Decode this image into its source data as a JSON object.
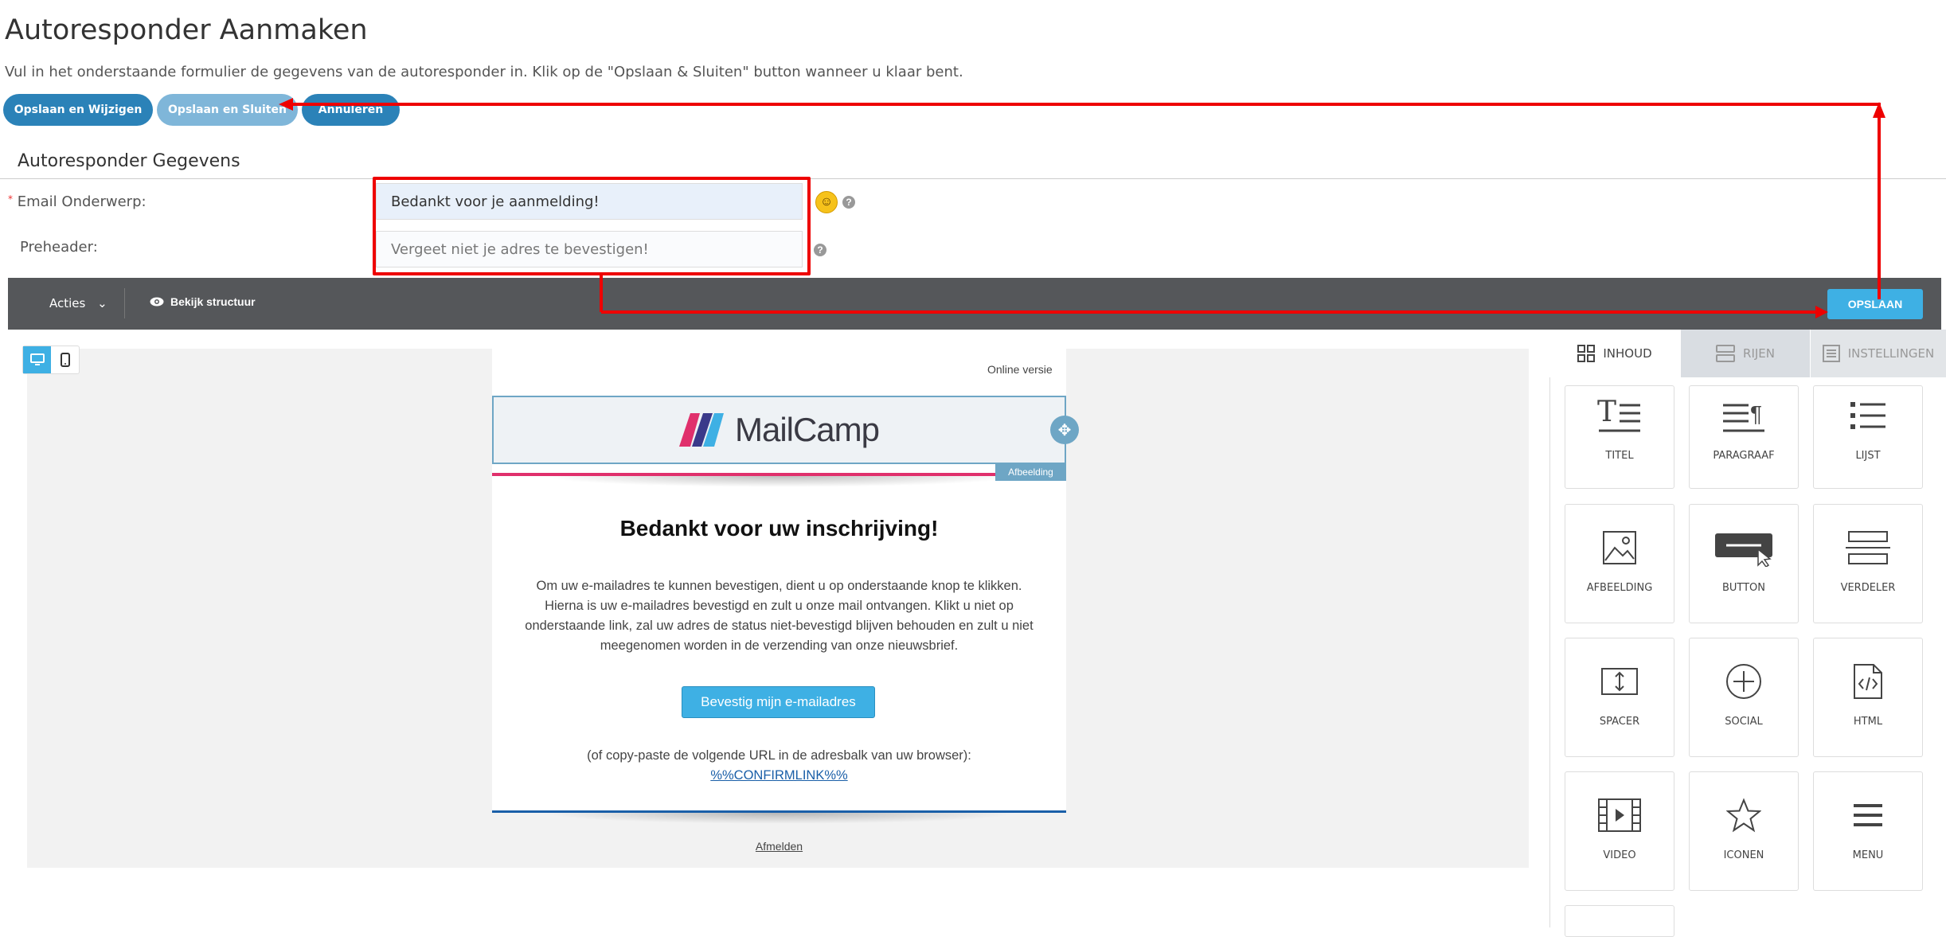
{
  "page": {
    "title": "Autoresponder Aanmaken",
    "intro": "Vul in het onderstaande formulier de gegevens van de autoresponder in. Klik op de \"Opslaan & Sluiten\" button wanneer u klaar bent."
  },
  "top_buttons": {
    "save_edit": "Opslaan en Wijzigen",
    "save_close": "Opslaan en Sluiten",
    "cancel": "Annuleren"
  },
  "section": {
    "title": "Autoresponder Gegevens"
  },
  "form": {
    "subject_label": "Email Onderwerp:",
    "subject_required": "*",
    "subject_value": "Bedankt voor je aanmelding!",
    "preheader_label": "Preheader:",
    "preheader_value": "Vergeet niet je adres te bevestigen!",
    "help": "?"
  },
  "editor_toolbar": {
    "actions": "Acties",
    "view_structure": "Bekijk structuur",
    "save": "OPSLAAN"
  },
  "email": {
    "online_version": "Online versie",
    "logo_text": "MailCamp",
    "image_badge": "Afbeelding",
    "heading": "Bedankt voor uw inschrijving!",
    "body": "Om uw e-mailadres te kunnen bevestigen, dient u op onderstaande knop te klikken. Hierna is uw e-mailadres bevestigd en zult u onze mail ontvangen. Klikt u niet op onderstaande link, zal uw adres de status niet-bevestigd blijven behouden en zult u niet meegenomen worden in de verzending van onze nieuwsbrief.",
    "button": "Bevestig mijn e-mailadres",
    "copy_text": "(of copy-paste de volgende URL in de adresbalk van uw browser):",
    "link": "%%CONFIRMLINK%%",
    "unsubscribe": "Afmelden"
  },
  "panel": {
    "tabs": [
      "INHOUD",
      "RIJEN",
      "INSTELLINGEN"
    ],
    "tiles": [
      "TITEL",
      "PARAGRAAF",
      "LIJST",
      "AFBEELDING",
      "BUTTON",
      "VERDELER",
      "SPACER",
      "SOCIAL",
      "HTML",
      "VIDEO",
      "ICONEN",
      "MENU"
    ]
  },
  "colors": {
    "primary_button": "#2b82b8",
    "secondary_button": "#7fb6d9",
    "toolbar": "#55575a",
    "accent": "#3eb0e4",
    "annotation": "#e00000"
  }
}
